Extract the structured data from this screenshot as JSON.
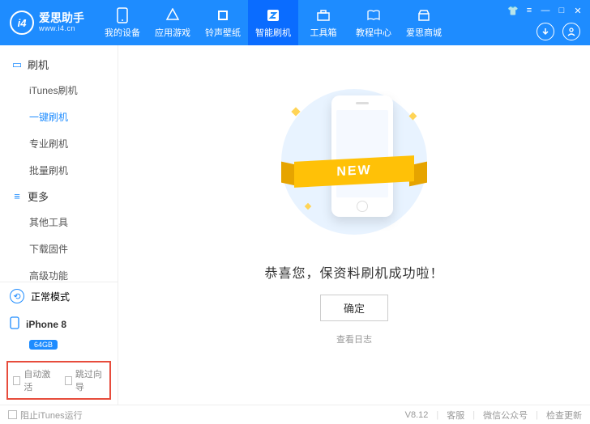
{
  "header": {
    "logoMark": "i4",
    "appName": "爱思助手",
    "appUrl": "www.i4.cn",
    "nav": [
      "我的设备",
      "应用游戏",
      "铃声壁纸",
      "智能刷机",
      "工具箱",
      "教程中心",
      "爱思商城"
    ],
    "activeNav": 3
  },
  "sidebar": {
    "group1": {
      "title": "刷机",
      "items": [
        "iTunes刷机",
        "一键刷机",
        "专业刷机",
        "批量刷机"
      ],
      "active": 1
    },
    "group2": {
      "title": "更多",
      "items": [
        "其他工具",
        "下载固件",
        "高级功能"
      ]
    },
    "mode": "正常模式",
    "device": "iPhone 8",
    "storage": "64GB",
    "chk1": "自动激活",
    "chk2": "跳过向导"
  },
  "main": {
    "ribbon": "NEW",
    "message": "恭喜您，保资料刷机成功啦！",
    "ok": "确定",
    "logLink": "查看日志"
  },
  "footer": {
    "blockItunes": "阻止iTunes运行",
    "version": "V8.12",
    "links": [
      "客服",
      "微信公众号",
      "检查更新"
    ]
  }
}
